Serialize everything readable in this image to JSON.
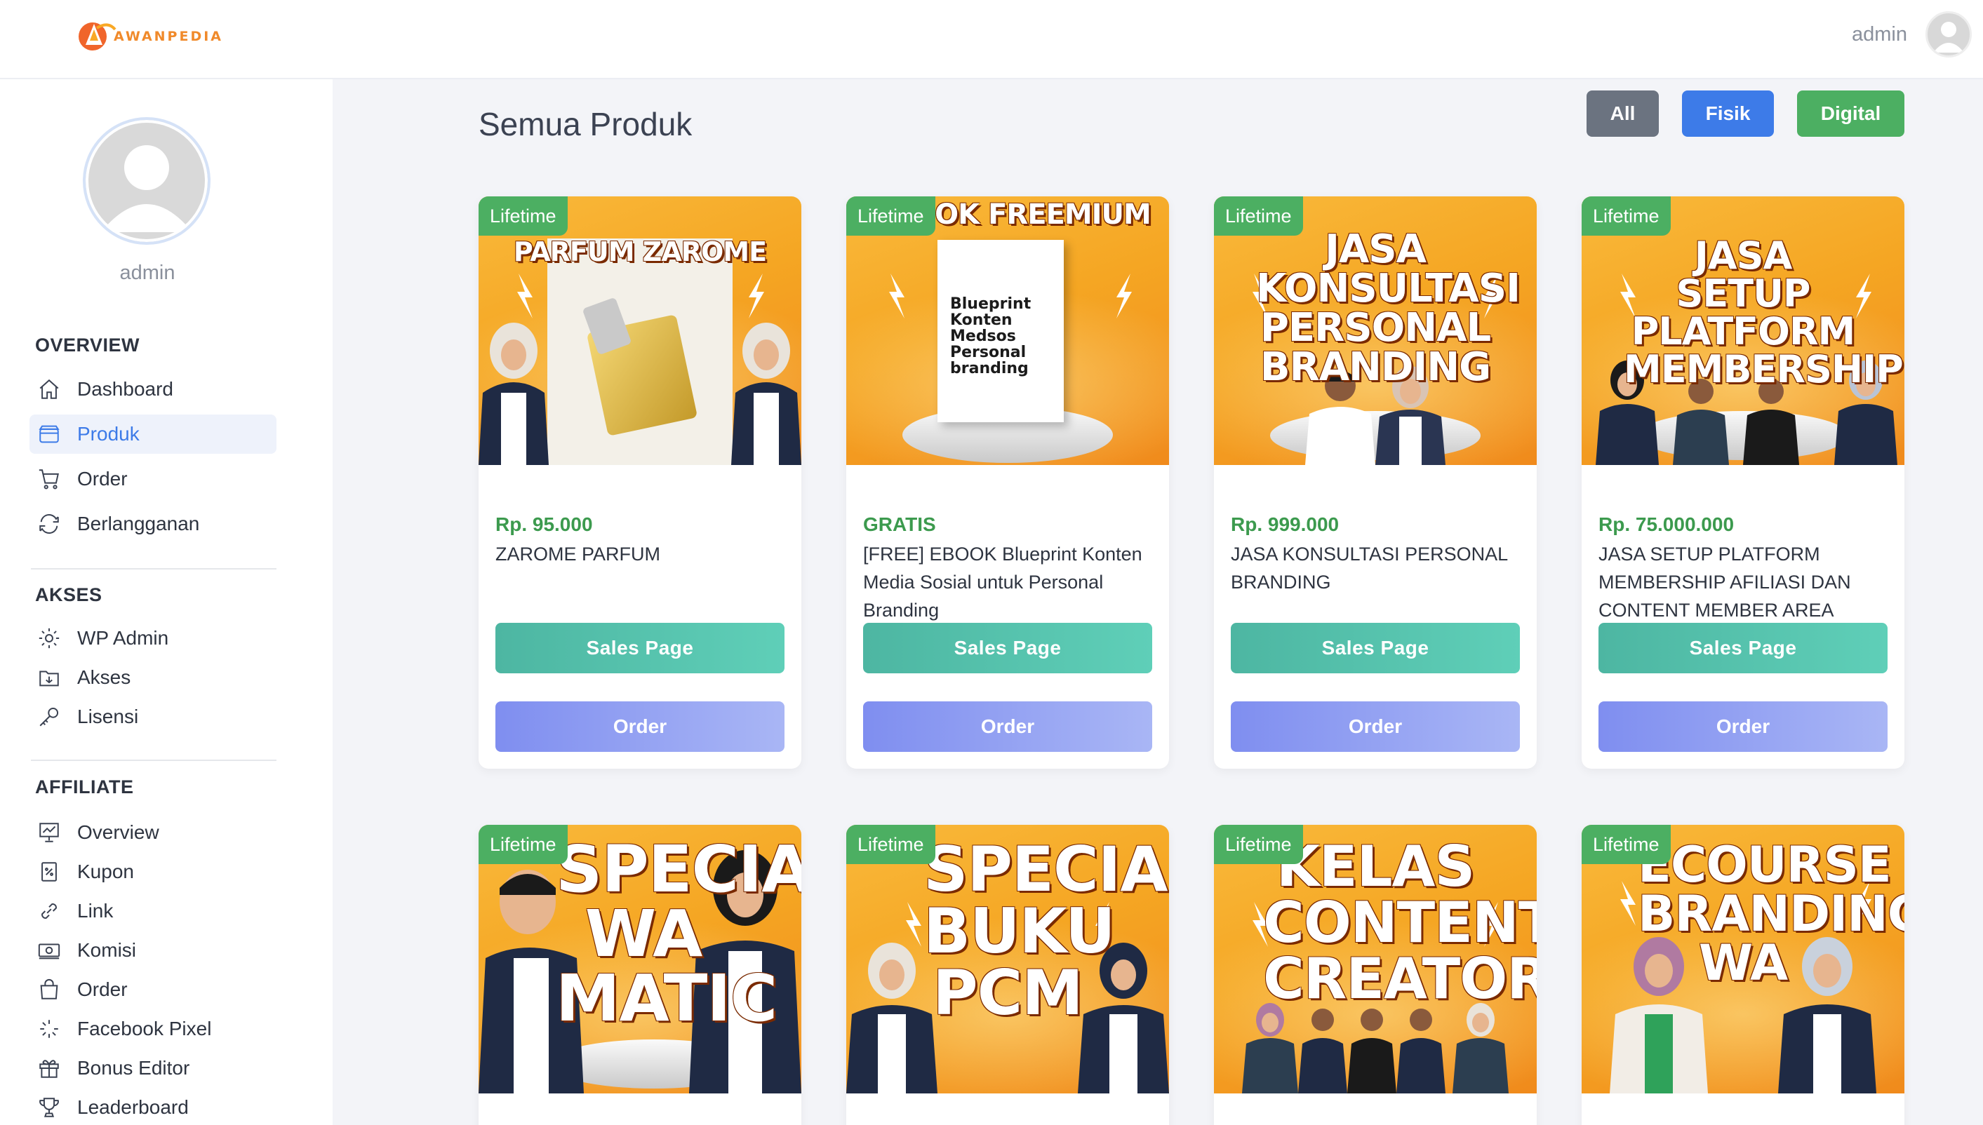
{
  "brand": {
    "name": "AWANPEDIA",
    "accent": "#f08a2b"
  },
  "header": {
    "username": "admin"
  },
  "sidebar": {
    "username": "admin",
    "sections": [
      {
        "title": "OVERVIEW",
        "items": [
          {
            "label": "Dashboard",
            "icon": "home-icon"
          },
          {
            "label": "Produk",
            "icon": "box-icon",
            "active": true
          },
          {
            "label": "Order",
            "icon": "cart-icon"
          },
          {
            "label": "Berlangganan",
            "icon": "refresh-icon"
          }
        ]
      },
      {
        "title": "AKSES",
        "items": [
          {
            "label": "WP Admin",
            "icon": "gear-icon"
          },
          {
            "label": "Akses",
            "icon": "download-folder-icon"
          },
          {
            "label": "Lisensi",
            "icon": "key-icon"
          }
        ]
      },
      {
        "title": "AFFILIATE",
        "items": [
          {
            "label": "Overview",
            "icon": "chart-board-icon"
          },
          {
            "label": "Kupon",
            "icon": "coupon-icon"
          },
          {
            "label": "Link",
            "icon": "link-icon"
          },
          {
            "label": "Komisi",
            "icon": "cash-icon"
          },
          {
            "label": "Order",
            "icon": "bag-icon"
          },
          {
            "label": "Facebook Pixel",
            "icon": "pixel-icon"
          },
          {
            "label": "Bonus Editor",
            "icon": "gift-icon"
          },
          {
            "label": "Leaderboard",
            "icon": "trophy-icon"
          }
        ]
      }
    ]
  },
  "main": {
    "title": "Semua Produk",
    "filters": [
      {
        "label": "All",
        "color": "#6b7380"
      },
      {
        "label": "Fisik",
        "color": "#3d7be8"
      },
      {
        "label": "Digital",
        "color": "#4caf62"
      }
    ],
    "products": [
      {
        "badge": "Lifetime",
        "thumb_title": "PARFUM ZAROME",
        "price": "Rp. 95.000",
        "name": "ZAROME PARFUM",
        "sales_label": "Sales Page",
        "order_label": "Order"
      },
      {
        "badge": "Lifetime",
        "thumb_title": "OK FREEMIUM",
        "book_text": "Blueprint Konten Medsos Personal branding",
        "price": "GRATIS",
        "name": "[FREE] EBOOK Blueprint Konten Media Sosial untuk Personal Branding",
        "sales_label": "Sales Page",
        "order_label": "Order"
      },
      {
        "badge": "Lifetime",
        "thumb_title": "JASA KONSULTASI PERSONAL BRANDING",
        "price": "Rp. 999.000",
        "name": "JASA KONSULTASI PERSONAL BRANDING",
        "sales_label": "Sales Page",
        "order_label": "Order"
      },
      {
        "badge": "Lifetime",
        "thumb_title": "JASA SETUP PLATFORM MEMBERSHIP",
        "price": "Rp. 75.000.000",
        "name": "JASA SETUP PLATFORM MEMBERSHIP AFILIASI DAN CONTENT MEMBER AREA",
        "sales_label": "Sales Page",
        "order_label": "Order"
      },
      {
        "badge": "Lifetime",
        "thumb_title": "SPECIAL WA MATIC"
      },
      {
        "badge": "Lifetime",
        "thumb_title": "SPECIAL BUKU PCM"
      },
      {
        "badge": "Lifetime",
        "thumb_title": "KELAS CONTENT CREATOR"
      },
      {
        "badge": "Lifetime",
        "thumb_title": "ECOURSE BRANDING WA"
      }
    ]
  }
}
